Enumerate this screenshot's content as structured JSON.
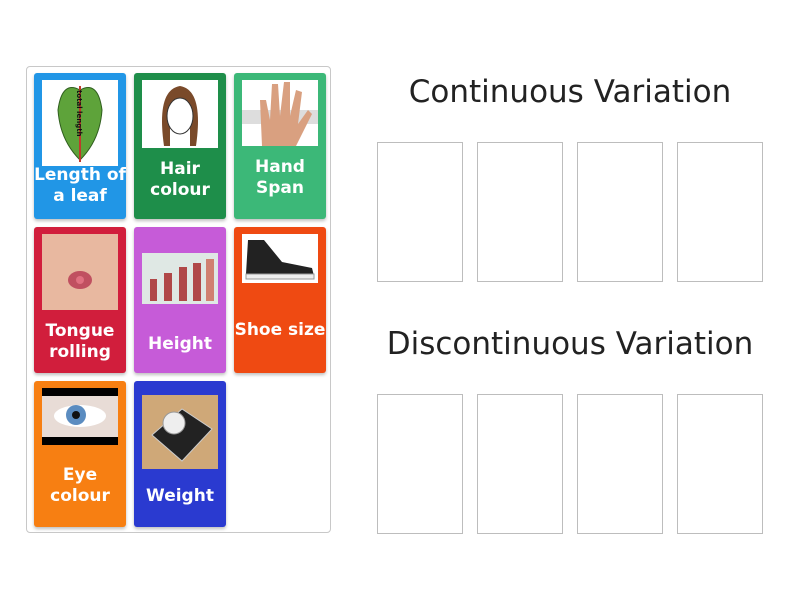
{
  "cards": [
    {
      "label": "Length of a leaf",
      "color": "#2196e6",
      "image": "leaf-image"
    },
    {
      "label": "Hair colour",
      "color": "#1e8e4a",
      "image": "hair-image"
    },
    {
      "label": "Hand Span",
      "color": "#3cb878",
      "image": "hand-image"
    },
    {
      "label": "Tongue rolling",
      "color": "#d11e3c",
      "image": "tongue-image"
    },
    {
      "label": "Height",
      "color": "#c65bd8",
      "image": "height-image"
    },
    {
      "label": "Shoe size",
      "color": "#ef4a12",
      "image": "shoe-image"
    },
    {
      "label": "Eye colour",
      "color": "#f77f12",
      "image": "eye-image"
    },
    {
      "label": "Weight",
      "color": "#2a3ad0",
      "image": "scale-image"
    }
  ],
  "leaf_annotation": "total length",
  "groups": [
    {
      "title": "Continuous Variation"
    },
    {
      "title": "Discontinuous Variation"
    }
  ]
}
